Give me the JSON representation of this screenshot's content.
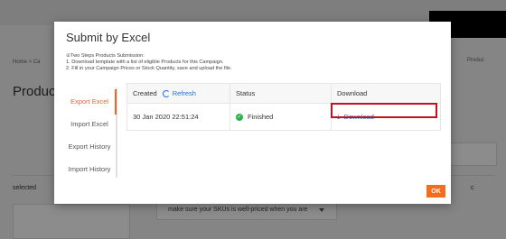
{
  "background": {
    "breadcrumb_left": "Home > Ca",
    "breadcrumb_right": "Produc",
    "page_title": "Product",
    "selected_label": "selected",
    "hint_text": "make sure your SKUs is well-priced when you are",
    "right_edge_text": "c"
  },
  "modal": {
    "title": "Submit by Excel",
    "instructions": [
      "②Two Steps Products Submission:",
      "1. Download template with a list of eligible Products for this Campaign.",
      "2. Fill in your Campaign Prices or Stock Quantity, save and upload the file."
    ],
    "tabs": [
      {
        "label": "Export Excel",
        "active": true
      },
      {
        "label": "Import Excel",
        "active": false
      },
      {
        "label": "Export History",
        "active": false
      },
      {
        "label": "Import History",
        "active": false
      }
    ],
    "table": {
      "headers": {
        "created": "Created",
        "refresh": "Refresh",
        "status": "Status",
        "download": "Download"
      },
      "rows": [
        {
          "created": "30 Jan 2020 22:51:24",
          "status": "Finished",
          "download": "Download"
        }
      ]
    },
    "ok_label": "OK"
  },
  "colors": {
    "accent": "#e8652c",
    "link": "#1a73e8",
    "success": "#2bb24c",
    "highlight": "#c0121f"
  },
  "icons": {
    "refresh": "refresh-icon",
    "status": "check-circle-icon",
    "download": "download-icon"
  }
}
